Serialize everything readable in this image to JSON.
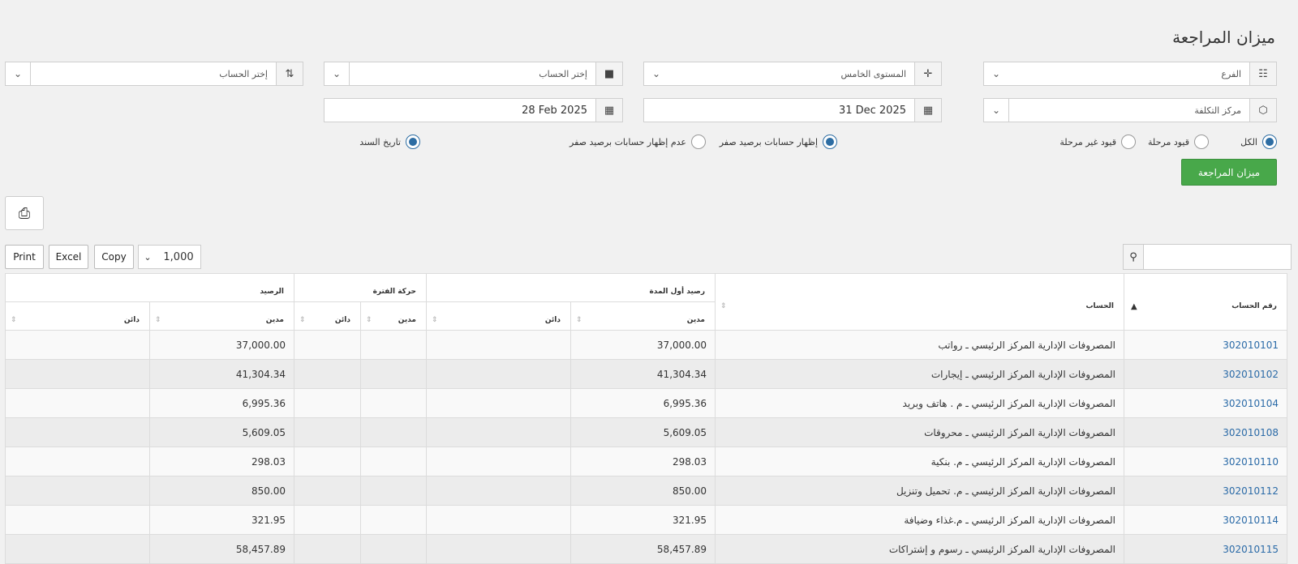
{
  "page": {
    "title": "ميزان المراجعة"
  },
  "filters": {
    "branch": {
      "value": "الفرع",
      "icon": "sitemap-icon"
    },
    "level": {
      "value": "المستوى الخامس",
      "icon": "crosshairs-icon"
    },
    "account_from": {
      "value": "إختر الحساب",
      "icon": "folder-icon"
    },
    "account_to": {
      "value": "إختر الحساب",
      "icon": "folder-open-icon"
    },
    "cost_center": {
      "value": "مركز التكلفة",
      "icon": "cube-icon"
    },
    "date_to": {
      "value": "31 Dec 2025",
      "icon": "calendar-icon"
    },
    "date_from": {
      "value": "28 Feb 2025",
      "icon": "calendar-icon"
    }
  },
  "radios": {
    "all": {
      "label": "الكل",
      "checked": true
    },
    "posted": {
      "label": "قيود مرحلة",
      "checked": false
    },
    "unposted": {
      "label": "قيود غير مرحلة",
      "checked": false
    },
    "show_zero": {
      "label": "إظهار حسابات برصيد صفر",
      "checked": true
    },
    "hide_zero": {
      "label": "عدم إظهار حسابات برصيد صفر",
      "checked": false
    },
    "doc_date": {
      "label": "تاريخ السند",
      "checked": true
    }
  },
  "actions": {
    "run_label": "ميزان المراجعة"
  },
  "toolbar": {
    "print": "Print",
    "excel": "Excel",
    "copy": "Copy",
    "page_size": "1,000"
  },
  "table": {
    "headers": {
      "account_no": "رقم الحساب",
      "account": "الحساب",
      "opening": "رصيد أول المدة",
      "movement": "حركة الفترة",
      "balance": "الرصيد",
      "debit": "مدين",
      "credit": "دائن"
    },
    "rows": [
      {
        "account_no": "302010101",
        "account": "المصروفات الإدارية المركز الرئيسي ـ رواتب",
        "opening_debit": "37,000.00",
        "balance_debit": "37,000.00"
      },
      {
        "account_no": "302010102",
        "account": "المصروفات الإدارية المركز الرئيسي ـ إيجارات",
        "opening_debit": "41,304.34",
        "balance_debit": "41,304.34"
      },
      {
        "account_no": "302010104",
        "account": "المصروفات الإدارية المركز الرئيسي ـ م . هاتف وبريد",
        "opening_debit": "6,995.36",
        "balance_debit": "6,995.36"
      },
      {
        "account_no": "302010108",
        "account": "المصروفات الإدارية المركز الرئيسي ـ محروقات",
        "opening_debit": "5,609.05",
        "balance_debit": "5,609.05"
      },
      {
        "account_no": "302010110",
        "account": "المصروفات الإدارية المركز الرئيسي ـ م. بنكية",
        "opening_debit": "298.03",
        "balance_debit": "298.03"
      },
      {
        "account_no": "302010112",
        "account": "المصروفات الإدارية المركز الرئيسي ـ م. تحميل وتنزيل",
        "opening_debit": "850.00",
        "balance_debit": "850.00"
      },
      {
        "account_no": "302010114",
        "account": "المصروفات الإدارية المركز الرئيسي ـ م.غذاء وضيافة",
        "opening_debit": "321.95",
        "balance_debit": "321.95"
      },
      {
        "account_no": "302010115",
        "account": "المصروفات الإدارية المركز الرئيسي ـ رسوم و إشتراكات",
        "opening_debit": "58,457.89",
        "balance_debit": "58,457.89"
      }
    ]
  }
}
